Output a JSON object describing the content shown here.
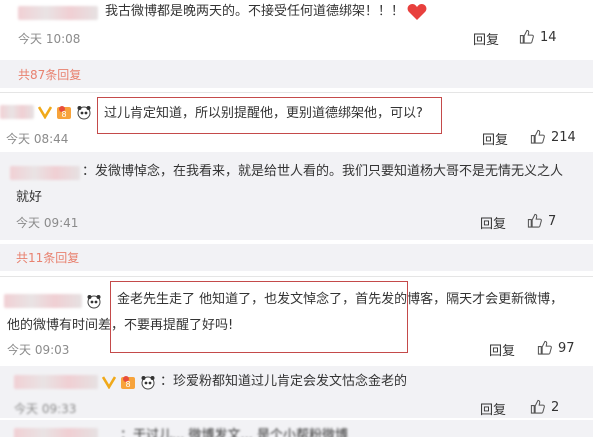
{
  "comments": [
    {
      "text": "我古微博都是晚两天的。不接受任何道德绑架！！！",
      "time": "今天 10:08",
      "reply_label": "回复",
      "likes": "14"
    },
    {
      "text": "过儿肯定知道，所以别提醒他，更别道德绑架他，可以?",
      "time": "今天 08:44",
      "reply_label": "回复",
      "likes": "214"
    },
    {
      "text_line1": "金老先生走了 他知道了，也发文悼念了，首先发的博客，隔天才会更新微博，",
      "text_line2": "他的微博有时间差，不要再提醒了好吗!",
      "time": "今天 09:03",
      "reply_label": "回复",
      "likes": "97"
    }
  ],
  "replies": [
    {
      "text_line1": "：发微博悼念，在我看来，就是给世人看的。我们只要知道杨大哥不是无情无义之人",
      "text_line2": "就好",
      "time": "今天 09:41",
      "reply_label": "回复",
      "likes": "7"
    },
    {
      "text": "：珍爱粉都知道过儿肯定会发文怙念金老的",
      "time": "今天 09:33",
      "reply_label": "回复",
      "likes": "2"
    },
    {
      "text": "：于过儿... 微博发文... 是个小帮粉微博"
    }
  ],
  "expand_links": {
    "first": "共87条回复",
    "second": "共11条回复"
  },
  "colors": {
    "highlight_box": "#c44a4a",
    "link": "#e8816f",
    "reply_bg": "#f2f2f5"
  }
}
